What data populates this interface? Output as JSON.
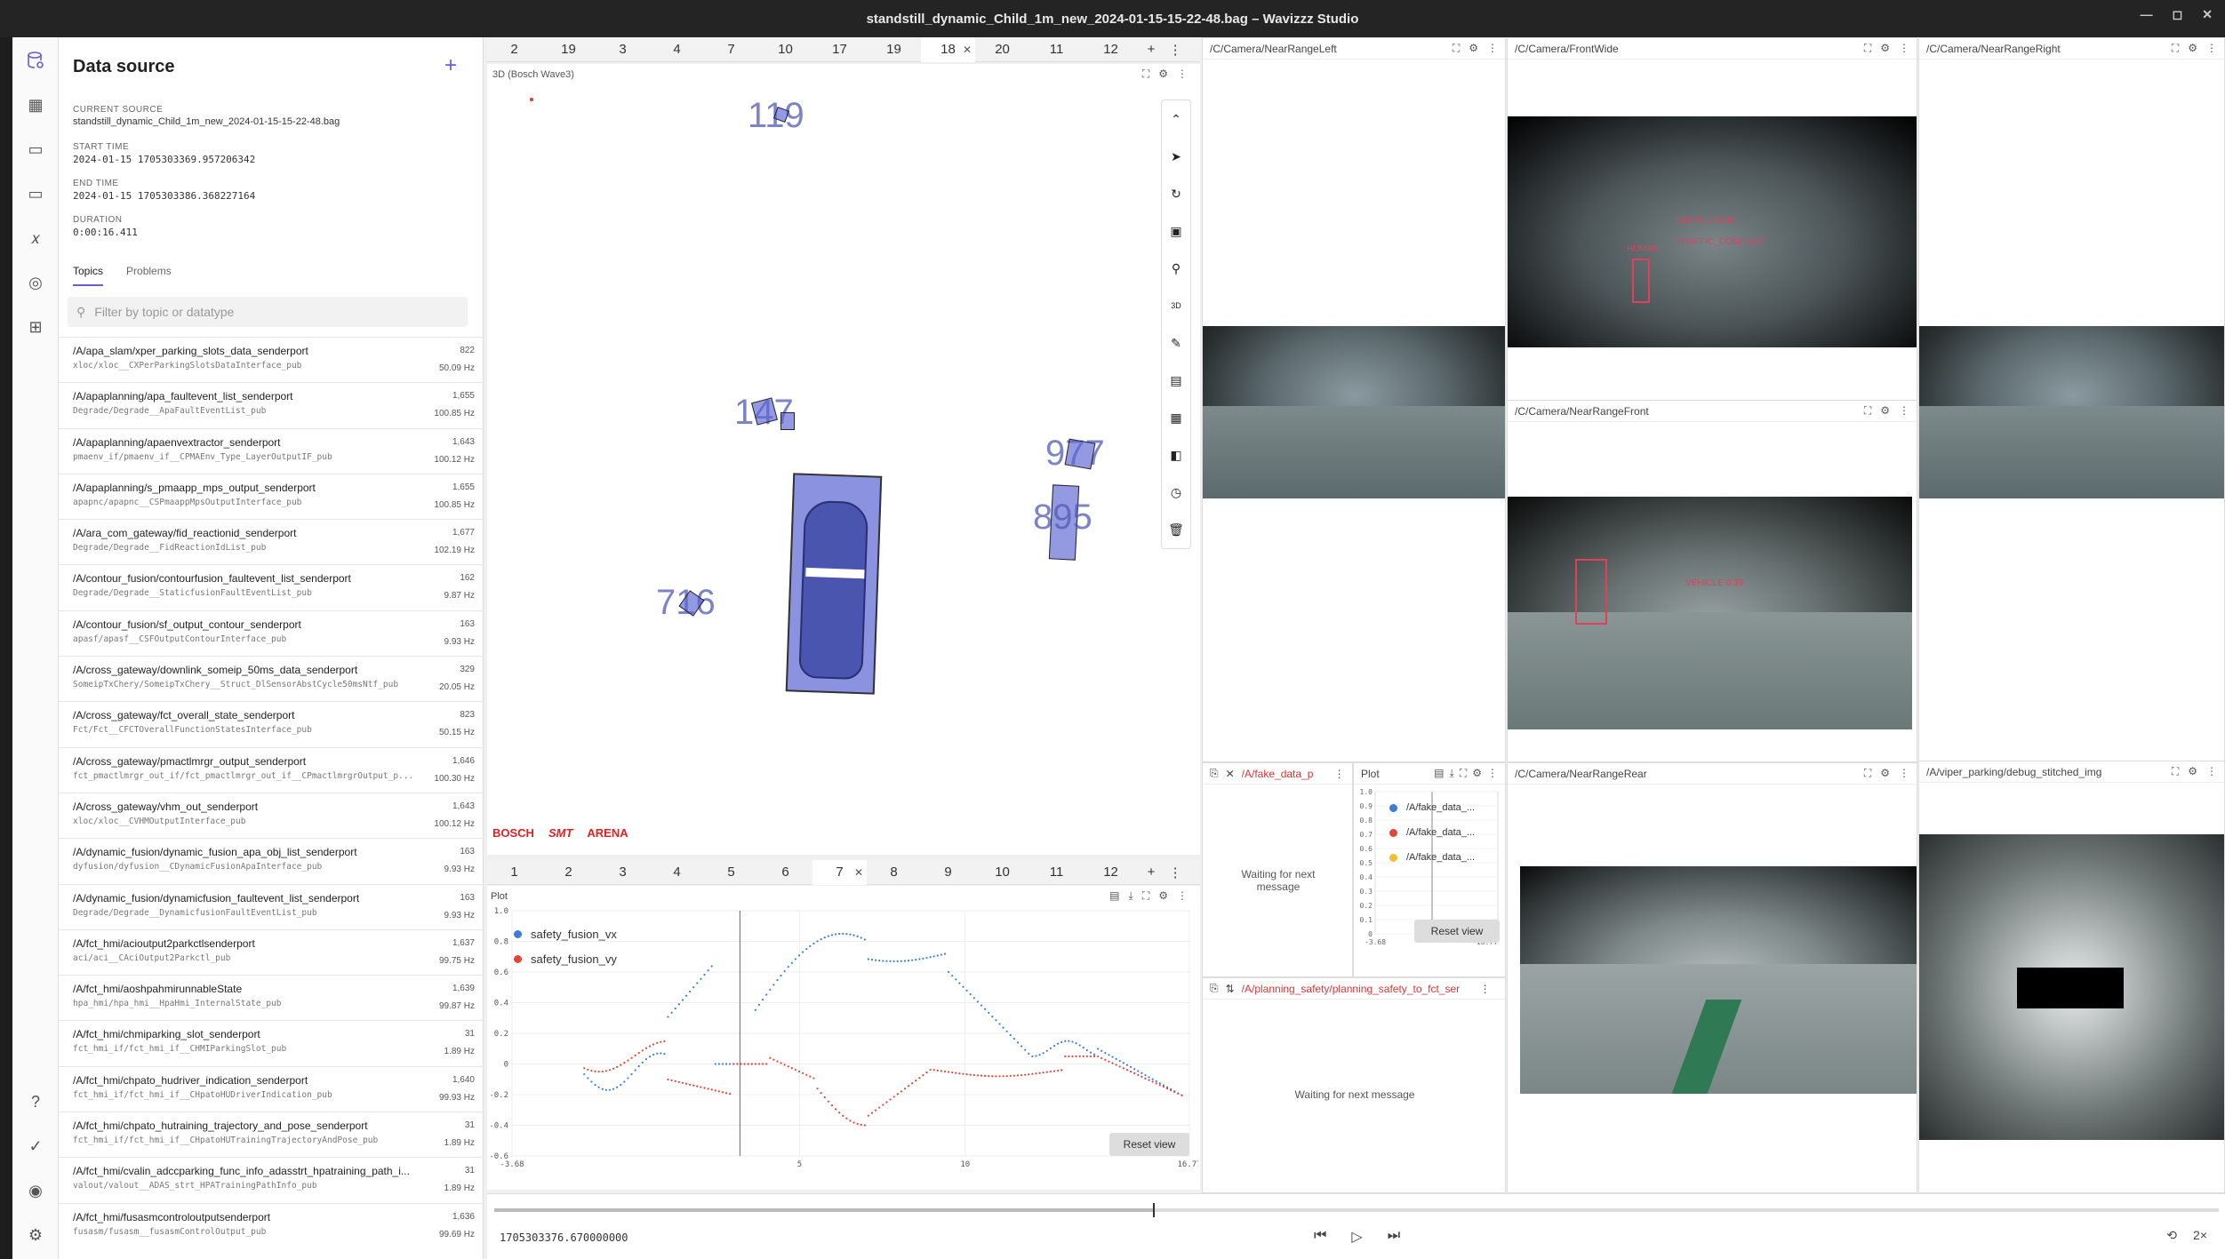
{
  "window": {
    "title": "standstill_dynamic_Child_1m_new_2024-01-15-15-22-48.bag – Wavizzz Studio"
  },
  "sidebar": {
    "title": "Data source",
    "current_source_label": "CURRENT SOURCE",
    "current_source": "standstill_dynamic_Child_1m_new_2024-01-15-15-22-48.bag",
    "start_time_label": "START TIME",
    "start_time": "2024-01-15 1705303369.957206342",
    "end_time_label": "END TIME",
    "end_time": "2024-01-15 1705303386.368227164",
    "duration_label": "DURATION",
    "duration": "0:00:16.411",
    "tab_topics": "Topics",
    "tab_problems": "Problems",
    "filter_placeholder": "Filter by topic or datatype",
    "topics": [
      {
        "name": "/A/apa_slam/xper_parking_slots_data_senderport",
        "type": "xloc/xloc__CXPerParkingSlotsDataInterface_pub",
        "count": "822",
        "hz": "50.09 Hz"
      },
      {
        "name": "/A/apaplanning/apa_faultevent_list_senderport",
        "type": "Degrade/Degrade__ApaFaultEventList_pub",
        "count": "1,655",
        "hz": "100.85 Hz"
      },
      {
        "name": "/A/apaplanning/apaenvextractor_senderport",
        "type": "pmaenv_if/pmaenv_if__CPMAEnv_Type_LayerOutputIF_pub",
        "count": "1,643",
        "hz": "100.12 Hz"
      },
      {
        "name": "/A/apaplanning/s_pmaapp_mps_output_senderport",
        "type": "apapnc/apapnc__CSPmaappMpsOutputInterface_pub",
        "count": "1,655",
        "hz": "100.85 Hz"
      },
      {
        "name": "/A/ara_com_gateway/fid_reactionid_senderport",
        "type": "Degrade/Degrade__FidReactionIdList_pub",
        "count": "1,677",
        "hz": "102.19 Hz"
      },
      {
        "name": "/A/contour_fusion/contourfusion_faultevent_list_senderport",
        "type": "Degrade/Degrade__StaticfusionFaultEventList_pub",
        "count": "162",
        "hz": "9.87 Hz"
      },
      {
        "name": "/A/contour_fusion/sf_output_contour_senderport",
        "type": "apasf/apasf__CSFOutputContourInterface_pub",
        "count": "163",
        "hz": "9.93 Hz"
      },
      {
        "name": "/A/cross_gateway/downlink_someip_50ms_data_senderport",
        "type": "SomeipTxChery/SomeipTxChery__Struct_DlSensorAbstCycle50msNtf_pub",
        "count": "329",
        "hz": "20.05 Hz"
      },
      {
        "name": "/A/cross_gateway/fct_overall_state_senderport",
        "type": "Fct/Fct__CFCTOverallFunctionStatesInterface_pub",
        "count": "823",
        "hz": "50.15 Hz"
      },
      {
        "name": "/A/cross_gateway/pmactlmrgr_output_senderport",
        "type": "fct_pmactlmrgr_out_if/fct_pmactlmrgr_out_if__CPmactlmrgrOutput_p...",
        "count": "1,646",
        "hz": "100.30 Hz"
      },
      {
        "name": "/A/cross_gateway/vhm_out_senderport",
        "type": "xloc/xloc__CVHMOutputInterface_pub",
        "count": "1,643",
        "hz": "100.12 Hz"
      },
      {
        "name": "/A/dynamic_fusion/dynamic_fusion_apa_obj_list_senderport",
        "type": "dyfusion/dyfusion__CDynamicFusionApaInterface_pub",
        "count": "163",
        "hz": "9.93 Hz"
      },
      {
        "name": "/A/dynamic_fusion/dynamicfusion_faultevent_list_senderport",
        "type": "Degrade/Degrade__DynamicfusionFaultEventList_pub",
        "count": "163",
        "hz": "9.93 Hz"
      },
      {
        "name": "/A/fct_hmi/acioutput2parkctlsenderport",
        "type": "aci/aci__CAciOutput2Parkctl_pub",
        "count": "1,637",
        "hz": "99.75 Hz"
      },
      {
        "name": "/A/fct_hmi/aoshpahmirunnableState",
        "type": "hpa_hmi/hpa_hmi__HpaHmi_InternalState_pub",
        "count": "1,639",
        "hz": "99.87 Hz"
      },
      {
        "name": "/A/fct_hmi/chmiparking_slot_senderport",
        "type": "fct_hmi_if/fct_hmi_if__CHMIParkingSlot_pub",
        "count": "31",
        "hz": "1.89 Hz"
      },
      {
        "name": "/A/fct_hmi/chpato_hudriver_indication_senderport",
        "type": "fct_hmi_if/fct_hmi_if__CHpatoHUDriverIndication_pub",
        "count": "1,640",
        "hz": "99.93 Hz"
      },
      {
        "name": "/A/fct_hmi/chpato_hutraining_trajectory_and_pose_senderport",
        "type": "fct_hmi_if/fct_hmi_if__CHpatoHUTrainingTrajectoryAndPose_pub",
        "count": "31",
        "hz": "1.89 Hz"
      },
      {
        "name": "/A/fct_hmi/cvalin_adccparking_func_info_adasstrt_hpatraining_path_i...",
        "type": "valout/valout__ADAS_strt_HPATrainingPathInfo_pub",
        "count": "31",
        "hz": "1.89 Hz"
      },
      {
        "name": "/A/fct_hmi/fusasmcontroloutputsenderport",
        "type": "fusasm/fusasm__fusasmControlOutput_pub",
        "count": "1,636",
        "hz": "99.69 Hz"
      }
    ]
  },
  "top_tabs": [
    "2",
    "19",
    "3",
    "4",
    "7",
    "10",
    "17",
    "19",
    "18",
    "20",
    "11",
    "12"
  ],
  "bottom_tabs": [
    "1",
    "2",
    "3",
    "4",
    "5",
    "6",
    "7",
    "8",
    "9",
    "10",
    "11",
    "12"
  ],
  "panel3d": {
    "title": "3D (Bosch Wave3)",
    "labels": [
      "119",
      "147",
      "977",
      "895",
      "716"
    ],
    "logos": [
      "BOSCH",
      "SMT",
      "ARENA"
    ],
    "tools": [
      "chevron-up-icon",
      "cursor-icon",
      "rotate-icon",
      "mouse-icon",
      "search-icon",
      "3D",
      "ruler-icon",
      "map-icon",
      "grid-icon",
      "layers-icon",
      "clock-icon",
      "trash-icon"
    ]
  },
  "plot_main": {
    "title": "Plot",
    "reset": "Reset view",
    "legend": [
      {
        "name": "safety_fusion_vx",
        "color": "#3b7dd8"
      },
      {
        "name": "safety_fusion_vy",
        "color": "#e0473a"
      }
    ],
    "yticks": [
      "1.0",
      "0.8",
      "0.6",
      "0.4",
      "0.2",
      "0",
      "-0.2",
      "-0.4",
      "-0.6"
    ],
    "xticks": [
      "-3.68",
      "5",
      "10",
      "16.77"
    ]
  },
  "cameras": {
    "left": "/C/Camera/NearRangeLeft",
    "front_wide": "/C/Camera/FrontWide",
    "right": "/C/Camera/NearRangeRight",
    "front": "/C/Camera/NearRangeFront",
    "rear": "/C/Camera/NearRangeRear",
    "stitched": "/A/viper_parking/debug_stitched_img",
    "det_labels": [
      "VEHICLE 0.38",
      "HUMAN",
      "TRAFFIC_CONE 0.27",
      "VEHICLE 0.39"
    ]
  },
  "fake_panel": {
    "topic": "/A/fake_data_p",
    "waiting": "Waiting for next message"
  },
  "mini_plot": {
    "title": "Plot",
    "legend": [
      {
        "name": "/A/fake_data_...",
        "color": "#3b7dd8"
      },
      {
        "name": "/A/fake_data_...",
        "color": "#e0473a"
      },
      {
        "name": "/A/fake_data_...",
        "color": "#f0c030"
      }
    ],
    "yticks": [
      "1.0",
      "0.9",
      "0.8",
      "0.7",
      "0.6",
      "0.5",
      "0.4",
      "0.3",
      "0.2",
      "0.1",
      "0"
    ],
    "xticks": [
      "-3.68",
      "16.77"
    ],
    "reset": "Reset view"
  },
  "planning_panel": {
    "topic": "/A/planning_safety/planning_safety_to_fct_ser",
    "waiting": "Waiting for next message"
  },
  "playback": {
    "time": "1705303376.670000000",
    "speed": "2×",
    "progress": 0.382
  }
}
